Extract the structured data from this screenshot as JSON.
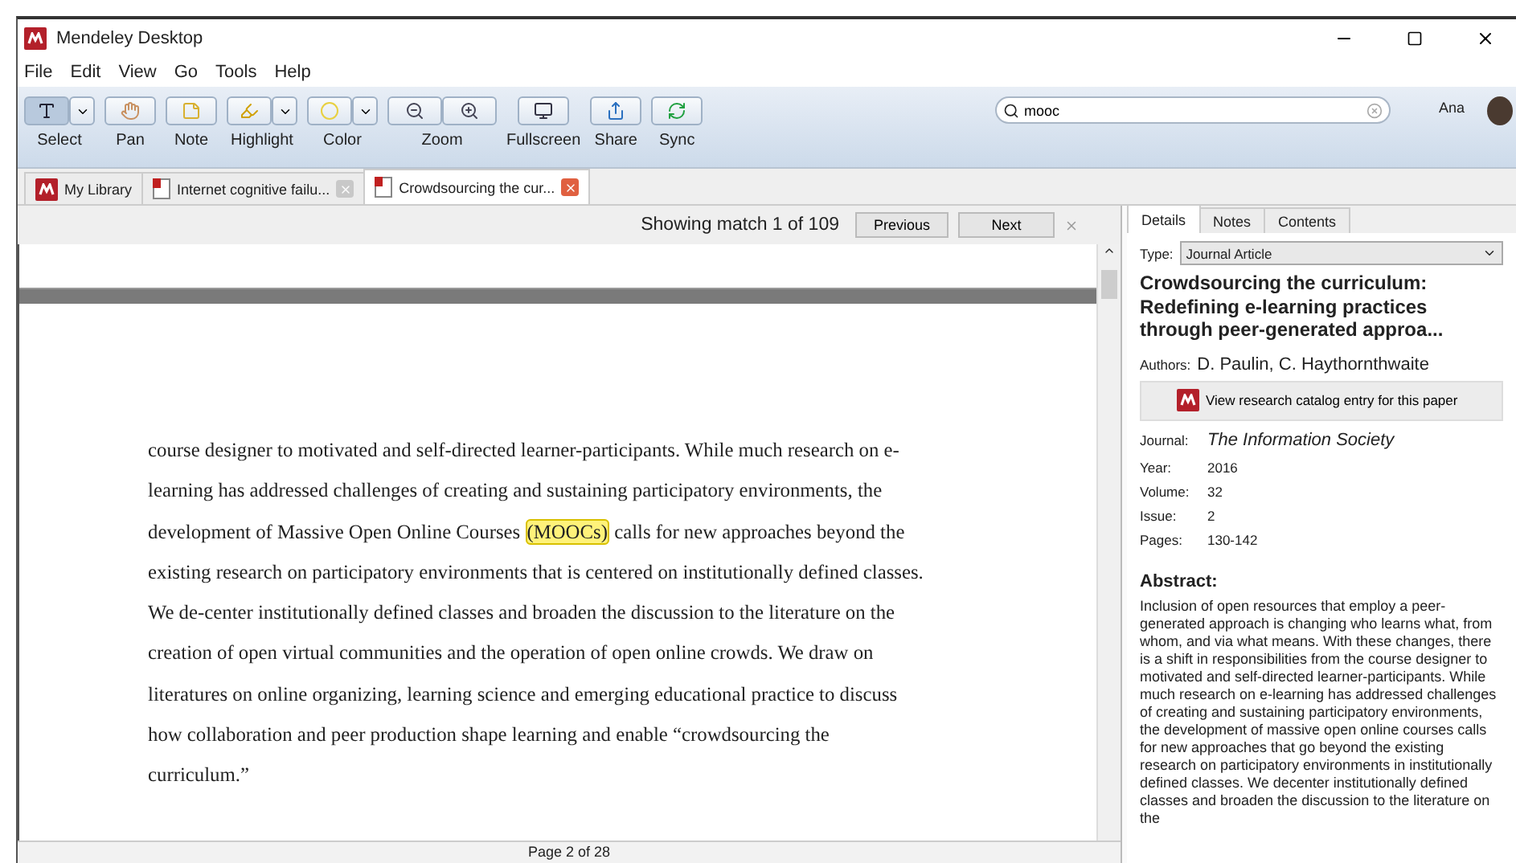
{
  "window": {
    "title": "Mendeley Desktop"
  },
  "menu": [
    "File",
    "Edit",
    "View",
    "Go",
    "Tools",
    "Help"
  ],
  "toolbar": [
    {
      "label": "Select",
      "kind": "split",
      "selected": true
    },
    {
      "label": "Pan",
      "kind": "single",
      "selected": false
    },
    {
      "label": "Note",
      "kind": "single",
      "selected": false
    },
    {
      "label": "Highlight",
      "kind": "split",
      "selected": false
    },
    {
      "label": "Color",
      "kind": "split",
      "selected": false
    },
    {
      "label": "Zoom",
      "kind": "pair",
      "selected": false
    },
    {
      "label": "Fullscreen",
      "kind": "single",
      "selected": false
    },
    {
      "label": "Share",
      "kind": "single",
      "selected": false
    },
    {
      "label": "Sync",
      "kind": "single",
      "selected": false
    }
  ],
  "search": {
    "value": "mooc"
  },
  "user": {
    "name": "Ana"
  },
  "tabs": [
    {
      "label": "My Library",
      "kind": "library",
      "selected": false
    },
    {
      "label": "Internet cognitive failu...",
      "kind": "pdf",
      "selected": false
    },
    {
      "label": "Crowdsourcing the cur...",
      "kind": "pdf",
      "selected": true
    }
  ],
  "find_bar": {
    "status": "Showing match 1 of 109",
    "buttons": [
      "Previous",
      "Next"
    ]
  },
  "document": {
    "lines": [
      {
        "segments": [
          {
            "text": "course designer to motivated and self-directed learner-participants. While much research on e-",
            "highlighted": false
          }
        ]
      },
      {
        "segments": [
          {
            "text": "learning has addressed challenges of creating and sustaining participatory environments, the",
            "highlighted": false
          }
        ]
      },
      {
        "segments": [
          {
            "text": "development of Massive Open Online Courses ",
            "highlighted": false
          },
          {
            "text": "(MOOCs)",
            "highlighted": true
          },
          {
            "text": " calls for new approaches beyond the",
            "highlighted": false
          }
        ]
      },
      {
        "segments": [
          {
            "text": "existing research on participatory environments that is centered on institutionally defined classes.",
            "highlighted": false
          }
        ]
      },
      {
        "segments": [
          {
            "text": "We de-center institutionally defined classes and broaden the discussion to the literature on the",
            "highlighted": false
          }
        ]
      },
      {
        "segments": [
          {
            "text": "creation of open virtual communities and the operation of open online crowds. We draw on",
            "highlighted": false
          }
        ]
      },
      {
        "segments": [
          {
            "text": "literatures on online organizing, learning science and emerging educational practice to discuss",
            "highlighted": false
          }
        ]
      },
      {
        "segments": [
          {
            "text": "how collaboration and peer production shape learning and enable “crowdsourcing the",
            "highlighted": false
          }
        ]
      },
      {
        "segments": [
          {
            "text": "curriculum.”",
            "highlighted": false
          }
        ]
      }
    ],
    "page_status": "Page 2 of 28"
  },
  "details": {
    "tabs": [
      {
        "label": "Details",
        "selected": true
      },
      {
        "label": "Notes",
        "selected": false
      },
      {
        "label": "Contents",
        "selected": false
      }
    ],
    "type_label": "Type:",
    "type_value": "Journal Article",
    "title": "Crowdsourcing the curriculum: Redefining e-learning practices through peer-generated approa...",
    "authors_label": "Authors:",
    "authors": "D. Paulin, C. Haythornthwaite",
    "catalog_button": "View research catalog entry for this paper",
    "fields": [
      {
        "label": "Journal:",
        "value": "The Information Society",
        "kind": "italic"
      },
      {
        "label": "Year:",
        "value": "2016",
        "kind": "plain"
      },
      {
        "label": "Volume:",
        "value": "32",
        "kind": "plain"
      },
      {
        "label": "Issue:",
        "value": "2",
        "kind": "plain"
      },
      {
        "label": "Pages:",
        "value": "130-142",
        "kind": "plain"
      }
    ],
    "abstract_heading": "Abstract:",
    "abstract": "Inclusion of open resources that employ a peer-generated approach is changing who learns what, from whom, and via what means. With these changes, there is a shift in responsibilities from the course designer to motivated and self-directed learner-participants. While much research on e-learning has addressed challenges of creating and sustaining participatory environments, the development of massive open online courses calls for new approaches that go beyond the existing research on participatory environments in institutionally defined classes. We decenter institutionally defined classes and broaden the discussion to the literature on the"
  }
}
